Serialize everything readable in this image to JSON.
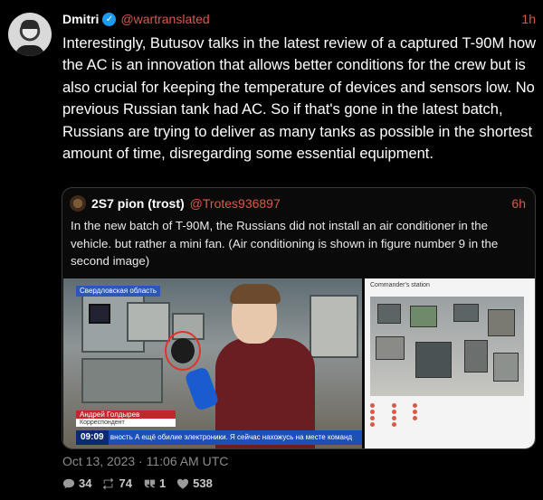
{
  "author": {
    "name": "Dmitri",
    "handle": "@wartranslated",
    "time": "1h",
    "verified_icon": "verified-badge-icon"
  },
  "tweet": {
    "text": "Interestingly, Butusov talks in the latest review of a captured T-90M how the AC is an innovation that allows better conditions for the crew but is also crucial for keeping the temperature of devices and sensors low. No previous Russian tank had AC. So if that's gone in the latest batch, Russians are trying to deliver as many tanks as possible in the shortest amount of time, disregarding some essential equipment."
  },
  "quoted": {
    "name": "2S7 pion (trost)",
    "handle": "@Trotes936897",
    "time": "6h",
    "text": "In the new batch of T-90M, the Russians did not install an air conditioner in the vehicle. but rather a mini fan. (Air conditioning is shown in figure number 9 in the second image)",
    "media": {
      "image1": {
        "region_label": "Свердловская область",
        "reporter_name": "Андрей Голдырев",
        "reporter_role": "Корреспондент",
        "clock": "09:09",
        "ticker": "вность   А ещё обилие электроники.   Я сейчас нахожусь на месте команд"
      },
      "image2": {
        "caption": "Commander's station"
      }
    }
  },
  "footer": {
    "timestamp": "Oct 13, 2023 · 11:06 AM UTC",
    "replies": "34",
    "retweets": "74",
    "quotes": "1",
    "likes": "538"
  },
  "colors": {
    "background": "#000000",
    "accent": "#d95a4a",
    "verified": "#1d9bf0"
  }
}
